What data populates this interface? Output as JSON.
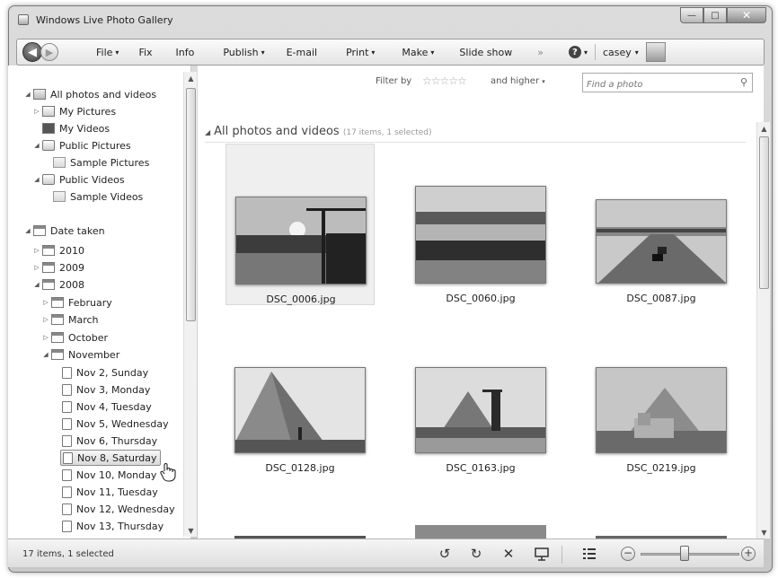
{
  "window": {
    "title": "Windows Live Photo Gallery"
  },
  "toolbar": {
    "items": [
      "File",
      "Fix",
      "Info",
      "Publish",
      "E-mail",
      "Print",
      "Make",
      "Slide show"
    ],
    "overflow": "»",
    "help_symbol": "?",
    "user": "casey"
  },
  "sidebar": {
    "root": "All photos and videos",
    "my_pictures": "My Pictures",
    "my_videos": "My Videos",
    "public_pictures": "Public Pictures",
    "sample_pictures": "Sample Pictures",
    "public_videos": "Public Videos",
    "sample_videos": "Sample Videos",
    "date_taken": "Date taken",
    "years": [
      "2010",
      "2009",
      "2008"
    ],
    "months": [
      "February",
      "March",
      "October",
      "November"
    ],
    "days": [
      "Nov 2, Sunday",
      "Nov 3, Monday",
      "Nov 4, Tuesday",
      "Nov 5, Wednesday",
      "Nov 6, Thursday",
      "Nov 8, Saturday",
      "Nov 10, Monday",
      "Nov 11, Tuesday",
      "Nov 12, Wednesday",
      "Nov 13, Thursday"
    ],
    "selected_day": "Nov 8, Saturday"
  },
  "filter": {
    "label": "Filter by",
    "stars": "☆☆☆☆☆",
    "and_higher": "and higher",
    "search_placeholder": "Find a photo"
  },
  "gallery": {
    "heading": "All photos and videos",
    "count": "(17 items, 1 selected)",
    "photos": [
      "DSC_0006.jpg",
      "DSC_0060.jpg",
      "DSC_0087.jpg",
      "DSC_0128.jpg",
      "DSC_0163.jpg",
      "DSC_0219.jpg"
    ]
  },
  "status": {
    "text": "17 items, 1 selected",
    "zoom_level": 0.42
  },
  "colors": {
    "frame": "#c8c8c8",
    "selection": "#efefef"
  }
}
